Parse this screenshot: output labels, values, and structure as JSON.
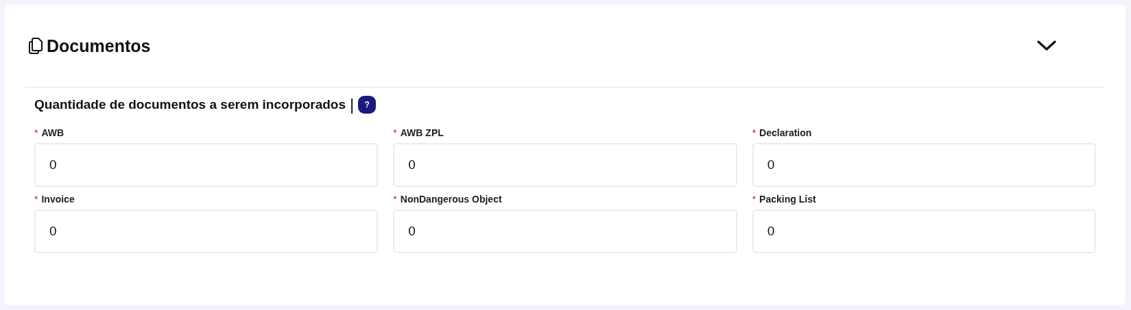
{
  "section": {
    "title": "Documentos",
    "expanded": true,
    "subtitle": "Quantidade de documentos a serem incorporados",
    "separator": "|",
    "help": "?",
    "fields": [
      {
        "required_mark": "*",
        "label": "AWB",
        "value": "0"
      },
      {
        "required_mark": "*",
        "label": "AWB ZPL",
        "value": "0"
      },
      {
        "required_mark": "*",
        "label": "Declaration",
        "value": "0"
      },
      {
        "required_mark": "*",
        "label": "Invoice",
        "value": "0"
      },
      {
        "required_mark": "*",
        "label": "NonDangerous Object",
        "value": "0"
      },
      {
        "required_mark": "*",
        "label": "Packing List",
        "value": "0"
      }
    ]
  }
}
